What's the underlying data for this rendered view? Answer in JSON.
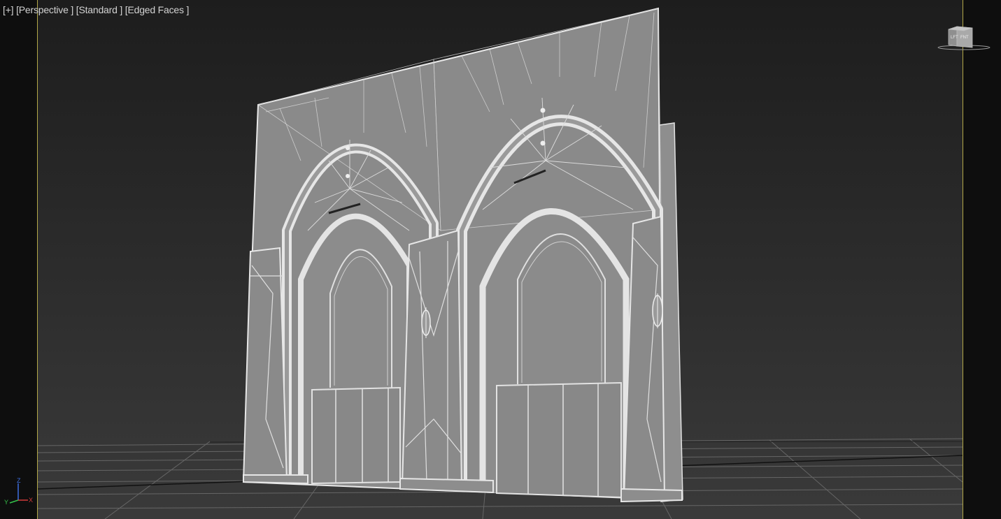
{
  "viewport": {
    "labels": {
      "plus": "[+]",
      "view": "[Perspective ]",
      "shading": "[Standard ]",
      "mode": "[Edged Faces ]"
    },
    "viewcube": {
      "face_left": "LFT",
      "face_right": "FNT"
    },
    "axis": {
      "x": "X",
      "y": "Y",
      "z": "Z"
    }
  },
  "colors": {
    "background": "#2a2a2a",
    "grid": "#6a6a6a",
    "wire": "#e2e2e2",
    "surface": "#8a8a8a",
    "safe_frame": "#b3a848",
    "axis_x": "#d23a3a",
    "axis_y": "#35c24a",
    "axis_z": "#3d6fe0"
  },
  "icons": {
    "viewcube": "viewcube-icon",
    "axis": "axis-tripod-icon"
  }
}
